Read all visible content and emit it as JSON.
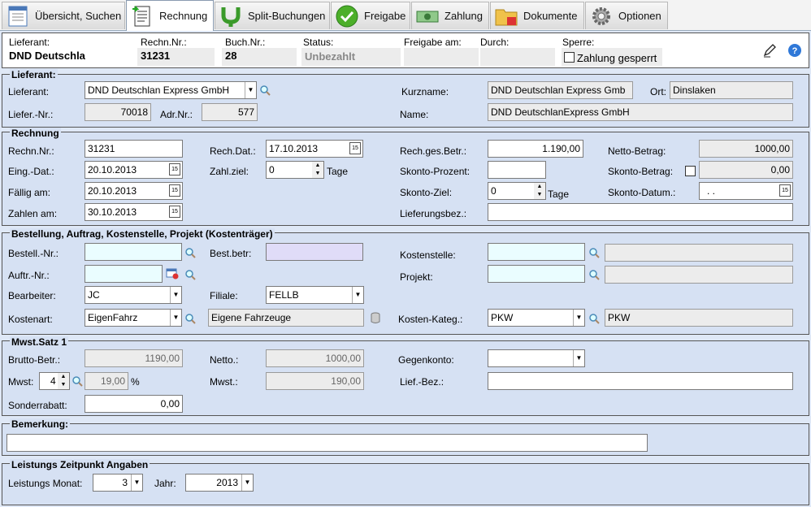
{
  "tabs": [
    {
      "label": "Übersicht, Suchen",
      "icon": "overview-icon"
    },
    {
      "label": "Rechnung",
      "icon": "invoice-icon"
    },
    {
      "label": "Split-Buchungen",
      "icon": "split-icon"
    },
    {
      "label": "Freigabe",
      "icon": "check-icon"
    },
    {
      "label": "Zahlung",
      "icon": "money-icon"
    },
    {
      "label": "Dokumente",
      "icon": "folder-icon"
    },
    {
      "label": "Optionen",
      "icon": "gear-icon"
    }
  ],
  "header": {
    "lieferant_label": "Lieferant:",
    "lieferant_value": "DND Deutschla",
    "rechnr_label": "Rechn.Nr.:",
    "rechnr_value": "31231",
    "buchnr_label": "Buch.Nr.:",
    "buchnr_value": "28",
    "status_label": "Status:",
    "status_value": "Unbezahlt",
    "freigabe_label": "Freigabe am:",
    "freigabe_value": "",
    "durch_label": "Durch:",
    "durch_value": "",
    "sperre_label": "Sperre:",
    "zahlung_gesperrt": "Zahlung gesperrt"
  },
  "lieferant": {
    "title": "Lieferant:",
    "lieferant_label": "Lieferant:",
    "lieferant_value": "DND Deutschlan Express GmbH",
    "kurzname_label": "Kurzname:",
    "kurzname_value": "DND Deutschlan Express Gmb",
    "ort_label": "Ort:",
    "ort_value": "Dinslaken",
    "liefernr_label": "Liefer.-Nr.:",
    "liefernr_value": "70018",
    "adrnr_label": "Adr.Nr.:",
    "adrnr_value": "577",
    "name_label": "Name:",
    "name_value": "DND DeutschlanExpress GmbH"
  },
  "rechnung": {
    "title": "Rechnung",
    "rechnr_label": "Rechn.Nr.:",
    "rechnr_value": "31231",
    "eingdat_label": "Eing.-Dat.:",
    "eingdat_value": "20.10.2013",
    "faellig_label": "Fällig am:",
    "faellig_value": "20.10.2013",
    "zahlen_label": "Zahlen am:",
    "zahlen_value": "30.10.2013",
    "rechdat_label": "Rech.Dat.:",
    "rechdat_value": "17.10.2013",
    "zahlziel_label": "Zahl.ziel:",
    "zahlziel_value": "0",
    "tage": "Tage",
    "gesbetr_label": "Rech.ges.Betr.:",
    "gesbetr_value": "1.190,00",
    "skontoproz_label": "Skonto-Prozent:",
    "skontoproz_value": "",
    "skontoziel_label": "Skonto-Ziel:",
    "skontoziel_value": "0",
    "lieferungsbez_label": "Lieferungsbez.:",
    "lieferungsbez_value": "",
    "netto_label": "Netto-Betrag:",
    "netto_value": "1000,00",
    "skontobetr_label": "Skonto-Betrag:",
    "skontobetr_value": "0,00",
    "skontodat_label": "Skonto-Datum.:",
    "skontodat_value": " .  ."
  },
  "bestellung": {
    "title": "Bestellung, Auftrag, Kostenstelle, Projekt (Kostenträger)",
    "bestellnr_label": "Bestell.-Nr.:",
    "bestellnr_value": "",
    "auftrnr_label": "Auftr.-Nr.:",
    "auftrnr_value": "",
    "bearbeiter_label": "Bearbeiter:",
    "bearbeiter_value": "JC",
    "kostenart_label": "Kostenart:",
    "kostenart_value": "EigenFahrz",
    "bestbetr_label": "Best.betr:",
    "bestbetr_value": "",
    "filiale_label": "Filiale:",
    "filiale_value": "FELLB",
    "kostenart_desc": "Eigene Fahrzeuge",
    "kostenstelle_label": "Kostenstelle:",
    "kostenstelle_value": "",
    "kostenstelle_desc": "",
    "projekt_label": "Projekt:",
    "projekt_value": "",
    "projekt_desc": "",
    "kostenkateg_label": "Kosten-Kateg.:",
    "kostenkateg_value": "PKW",
    "kostenkateg_desc": "PKW"
  },
  "mwst": {
    "title": "Mwst.Satz 1",
    "brutto_label": "Brutto-Betr.:",
    "brutto_value": "1190,00",
    "mwst_label": "Mwst:",
    "mwst_code": "4",
    "mwst_rate": "19,00",
    "percent": "%",
    "sonderrabatt_label": "Sonderrabatt:",
    "sonderrabatt_value": "0,00",
    "netto_label": "Netto.:",
    "netto_value": "1000,00",
    "mwst2_label": "Mwst.:",
    "mwst2_value": "190,00",
    "gegenkonto_label": "Gegenkonto:",
    "gegenkonto_value": "",
    "liefbez_label": "Lief.-Bez.:",
    "liefbez_value": ""
  },
  "bemerkung": {
    "title": "Bemerkung:",
    "value": ""
  },
  "leistung": {
    "title": "Leistungs Zeitpunkt Angaben",
    "monat_label": "Leistungs Monat:",
    "monat_value": "3",
    "jahr_label": "Jahr:",
    "jahr_value": "2013"
  }
}
